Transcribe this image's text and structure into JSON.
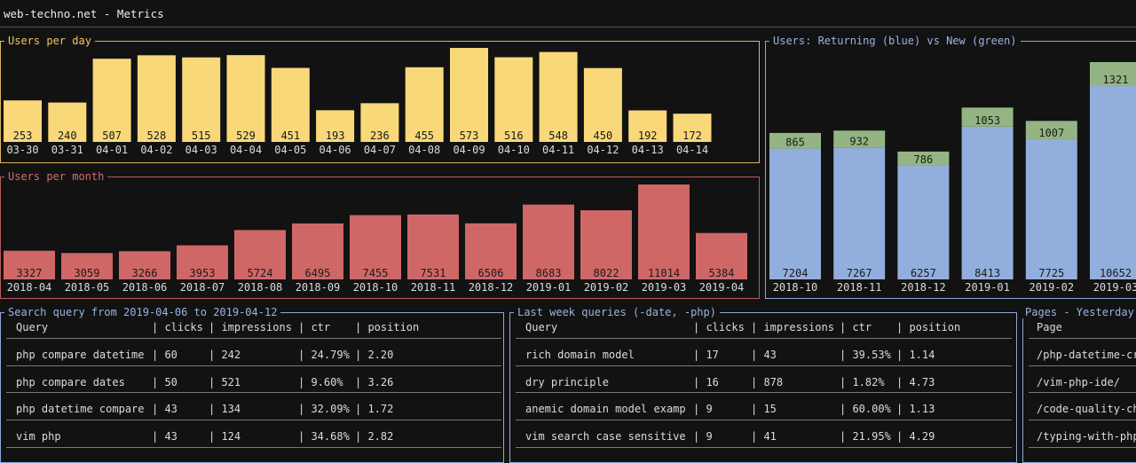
{
  "title": "web-techno.net - Metrics",
  "colors": {
    "yellow": "#f9d87a",
    "red": "#cf6767",
    "blue": "#92aedc",
    "green": "#94b583",
    "blue_border": "#8fa8d8",
    "table_border": "#8fa8d8"
  },
  "users_per_day": {
    "title": "Users per day",
    "chart_data": {
      "type": "bar",
      "categories": [
        "03-30",
        "03-31",
        "04-01",
        "04-02",
        "04-03",
        "04-04",
        "04-05",
        "04-06",
        "04-07",
        "04-08",
        "04-09",
        "04-10",
        "04-11",
        "04-12",
        "04-13",
        "04-14"
      ],
      "values": [
        253,
        240,
        507,
        528,
        515,
        529,
        451,
        193,
        236,
        455,
        573,
        516,
        548,
        450,
        192,
        172
      ]
    }
  },
  "users_per_month": {
    "title": "Users per month",
    "chart_data": {
      "type": "bar",
      "categories": [
        "2018-04",
        "2018-05",
        "2018-06",
        "2018-07",
        "2018-08",
        "2018-09",
        "2018-10",
        "2018-11",
        "2018-12",
        "2019-01",
        "2019-02",
        "2019-03",
        "2019-04"
      ],
      "values": [
        3327,
        3059,
        3266,
        3953,
        5724,
        6495,
        7455,
        7531,
        6506,
        8683,
        8022,
        11014,
        5384
      ]
    }
  },
  "returning_vs_new": {
    "title": "Users: Returning (blue) vs New (green)",
    "chart_data": {
      "type": "bar",
      "stacked": true,
      "categories": [
        "2018-10",
        "2018-11",
        "2018-12",
        "2019-01",
        "2019-02",
        "2019-03"
      ],
      "series": [
        {
          "name": "Returning",
          "values": [
            7204,
            7267,
            6257,
            8413,
            7725,
            10652
          ]
        },
        {
          "name": "New",
          "values": [
            865,
            932,
            786,
            1053,
            1007,
            1321
          ]
        }
      ]
    }
  },
  "search_query": {
    "title": "Search query from 2019-04-06 to 2019-04-12",
    "headers": [
      "Query",
      "clicks",
      "impressions",
      "ctr",
      "position"
    ],
    "rows": [
      [
        "php compare datetime",
        "60",
        "242",
        "24.79%",
        "2.20"
      ],
      [
        "php compare dates",
        "50",
        "521",
        "9.60%",
        "3.26"
      ],
      [
        "php datetime compare",
        "43",
        "134",
        "32.09%",
        "1.72"
      ],
      [
        "vim php",
        "43",
        "124",
        "34.68%",
        "2.82"
      ]
    ]
  },
  "last_week": {
    "title": "Last week queries (-date, -php)",
    "headers": [
      "Query",
      "clicks",
      "impressions",
      "ctr",
      "position"
    ],
    "rows": [
      [
        "rich domain model",
        "17",
        "43",
        "39.53%",
        "1.14"
      ],
      [
        "dry principle",
        "16",
        "878",
        "1.82%",
        "4.73"
      ],
      [
        "anemic domain model examp",
        "9",
        "15",
        "60.00%",
        "1.13"
      ],
      [
        "vim search case sensitive",
        "9",
        "41",
        "21.95%",
        "4.29"
      ]
    ]
  },
  "pages": {
    "title": "Pages - Yesterday",
    "headers": [
      "Page"
    ],
    "rows": [
      [
        "/php-datetime-cr"
      ],
      [
        "/vim-php-ide/"
      ],
      [
        "/code-quality-ch"
      ],
      [
        "/typing-with-php"
      ]
    ]
  }
}
